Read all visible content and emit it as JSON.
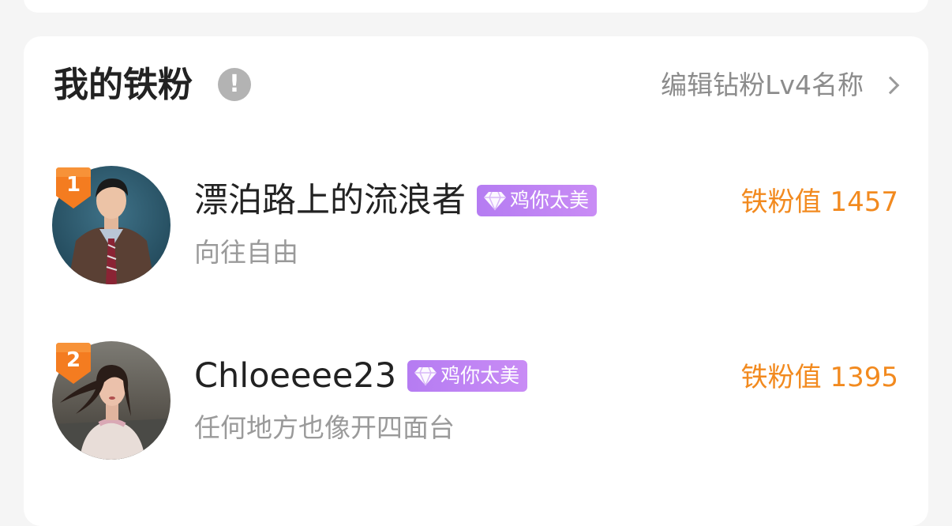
{
  "header": {
    "title": "我的铁粉",
    "info_icon": "exclamation-circle-icon",
    "info_symbol": "!",
    "edit_link_label": "编辑钻粉Lv4名称",
    "edit_link_icon": "chevron-right-icon"
  },
  "colors": {
    "score": "#f28a1f",
    "badge": "#f47c20",
    "tag": "#b57cf2",
    "title": "#222222",
    "secondary": "#9a9a9a"
  },
  "fans": [
    {
      "rank": "1",
      "name": "漂泊路上的流浪者",
      "tag_label": "鸡你太美",
      "tag_icon": "diamond-icon",
      "motto": "向往自由",
      "score_label": "铁粉值 1457"
    },
    {
      "rank": "2",
      "name": "Chloeeee23",
      "tag_label": "鸡你太美",
      "tag_icon": "diamond-icon",
      "motto": "任何地方也像开四面台",
      "score_label": "铁粉值 1395"
    }
  ]
}
